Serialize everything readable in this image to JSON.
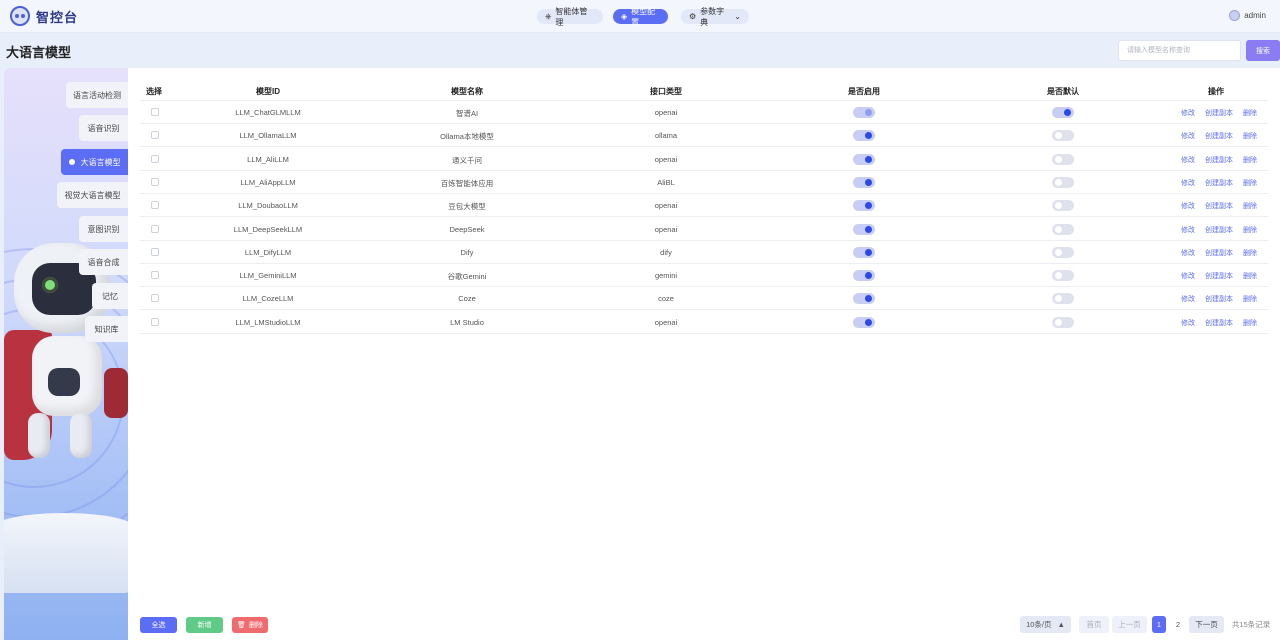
{
  "header": {
    "logo_text": "智控台",
    "nav": [
      {
        "label": "智能体管理",
        "icon": "agent-icon"
      },
      {
        "label": "模型配置",
        "icon": "model-icon"
      },
      {
        "label": "参数字典",
        "icon": "dict-icon"
      }
    ],
    "user": "admin"
  },
  "page": {
    "title": "大语言模型",
    "search_placeholder": "请输入模型名称查询",
    "search_label": "搜索"
  },
  "sidebar": {
    "items": [
      {
        "label": "语言活动检测",
        "active": false
      },
      {
        "label": "语音识别",
        "active": false
      },
      {
        "label": "大语言模型",
        "active": true
      },
      {
        "label": "视觉大语言模型",
        "active": false
      },
      {
        "label": "意图识别",
        "active": false
      },
      {
        "label": "语音合成",
        "active": false
      },
      {
        "label": "记忆",
        "active": false
      },
      {
        "label": "知识库",
        "active": false
      }
    ]
  },
  "table": {
    "headers": [
      "选择",
      "模型ID",
      "模型名称",
      "接口类型",
      "是否启用",
      "是否默认",
      "操作"
    ],
    "ops": [
      "修改",
      "创建副本",
      "删除"
    ],
    "rows": [
      {
        "id": "LLM_ChatGLMLLM",
        "name": "智谱AI",
        "type": "openai",
        "enabled": true,
        "default": true
      },
      {
        "id": "LLM_OllamaLLM",
        "name": "Ollama本地模型",
        "type": "ollama",
        "enabled": true,
        "default": false
      },
      {
        "id": "LLM_AliLLM",
        "name": "通义千问",
        "type": "openai",
        "enabled": true,
        "default": false
      },
      {
        "id": "LLM_AliAppLLM",
        "name": "百炼智能体应用",
        "type": "AliBL",
        "enabled": true,
        "default": false
      },
      {
        "id": "LLM_DoubaoLLM",
        "name": "豆包大模型",
        "type": "openai",
        "enabled": true,
        "default": false
      },
      {
        "id": "LLM_DeepSeekLLM",
        "name": "DeepSeek",
        "type": "openai",
        "enabled": true,
        "default": false
      },
      {
        "id": "LLM_DifyLLM",
        "name": "Dify",
        "type": "dify",
        "enabled": true,
        "default": false
      },
      {
        "id": "LLM_GeminiLLM",
        "name": "谷歌Gemini",
        "type": "gemini",
        "enabled": true,
        "default": false
      },
      {
        "id": "LLM_CozeLLM",
        "name": "Coze",
        "type": "coze",
        "enabled": true,
        "default": false
      },
      {
        "id": "LLM_LMStudioLLM",
        "name": "LM Studio",
        "type": "openai",
        "enabled": true,
        "default": false
      }
    ]
  },
  "footer": {
    "select_all": "全选",
    "add": "新增",
    "delete": "删除",
    "page_size": "10条/页",
    "first": "首页",
    "prev": "上一页",
    "pages": [
      "1",
      "2"
    ],
    "next": "下一页",
    "total": "共15条记录"
  }
}
